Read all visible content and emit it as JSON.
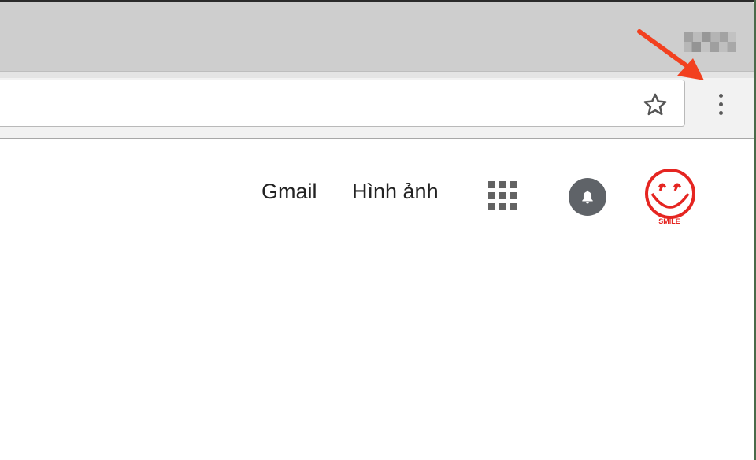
{
  "browser": {
    "menu_button_label": "Customize and control Google Chrome",
    "bookmark_label": "Bookmark this page"
  },
  "google_bar": {
    "gmail_label": "Gmail",
    "images_label": "Hình ảnh"
  },
  "avatar": {
    "caption": "SMILE"
  },
  "icons": {
    "star": "star-outline-icon",
    "menu": "vertical-dots-icon",
    "apps": "apps-grid-icon",
    "notifications": "bell-icon",
    "annotation": "red-arrow"
  },
  "colors": {
    "arrow": "#f2401f",
    "avatar_red": "#e52521",
    "notif_bg": "#5f6368"
  }
}
